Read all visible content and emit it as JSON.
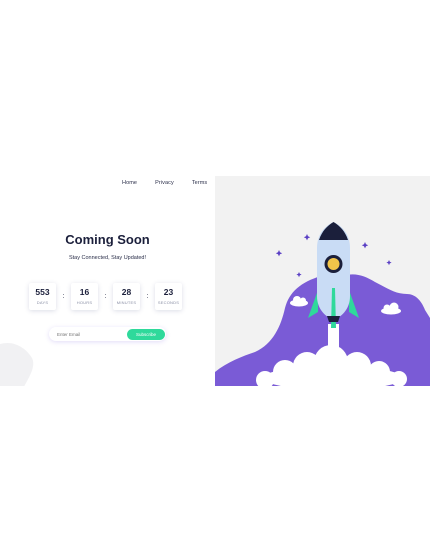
{
  "nav": {
    "items": [
      {
        "label": "Home"
      },
      {
        "label": "Privacy"
      },
      {
        "label": "Terms"
      }
    ]
  },
  "hero": {
    "title": "Coming Soon",
    "subtitle": "Stay Connected, Stay Updated!"
  },
  "countdown": {
    "days": {
      "value": "553",
      "label": "DAYS"
    },
    "hours": {
      "value": "16",
      "label": "HOURS"
    },
    "minutes": {
      "value": "28",
      "label": "MINUTES"
    },
    "seconds": {
      "value": "23",
      "label": "SECONDS"
    },
    "separator": ":"
  },
  "subscribe": {
    "placeholder": "Enter Email",
    "button_label": "Subscribe"
  },
  "colors": {
    "purple": "#7a5bd6",
    "green": "#2fd99b",
    "navy": "#1b1f3b",
    "rocket_body": "#c9dcf5",
    "window": "#f2c54a",
    "panel": "#f2f2f2"
  },
  "icons": {
    "rocket": "rocket-icon",
    "star": "star-icon",
    "cloud": "cloud-icon"
  }
}
